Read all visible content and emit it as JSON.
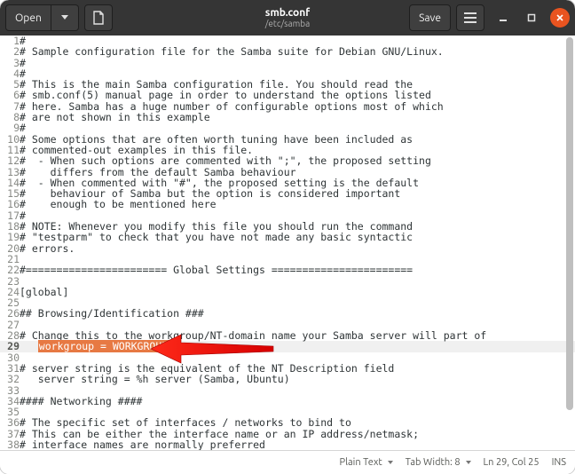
{
  "header": {
    "open_label": "Open",
    "title": "smb.conf",
    "subtitle": "/etc/samba",
    "save_label": "Save"
  },
  "code": {
    "lines": [
      "#",
      "# Sample configuration file for the Samba suite for Debian GNU/Linux.",
      "#",
      "#",
      "# This is the main Samba configuration file. You should read the",
      "# smb.conf(5) manual page in order to understand the options listed",
      "# here. Samba has a huge number of configurable options most of which",
      "# are not shown in this example",
      "#",
      "# Some options that are often worth tuning have been included as",
      "# commented-out examples in this file.",
      "#  - When such options are commented with \";\", the proposed setting",
      "#    differs from the default Samba behaviour",
      "#  - When commented with \"#\", the proposed setting is the default",
      "#    behaviour of Samba but the option is considered important",
      "#    enough to be mentioned here",
      "#",
      "# NOTE: Whenever you modify this file you should run the command",
      "# \"testparm\" to check that you have not made any basic syntactic",
      "# errors.",
      "",
      "#======================= Global Settings =======================",
      "",
      "[global]",
      "",
      "## Browsing/Identification ###",
      "",
      "# Change this to the workgroup/NT-domain name your Samba server will part of",
      "",
      "",
      "# server string is the equivalent of the NT Description field",
      "   server string = %h server (Samba, Ubuntu)",
      "",
      "#### Networking ####",
      "",
      "# The specific set of interfaces / networks to bind to",
      "# This can be either the interface name or an IP address/netmask;",
      "# interface names are normally preferred"
    ],
    "highlight_line_index": 28,
    "highlight_prefix": "   ",
    "highlight_text": "workgroup = WORKGROUP",
    "first_line_number": 1
  },
  "status": {
    "syntax": "Plain Text",
    "tabwidth": "Tab Width: 8",
    "position": "Ln 29, Col 25",
    "ins": "INS"
  }
}
